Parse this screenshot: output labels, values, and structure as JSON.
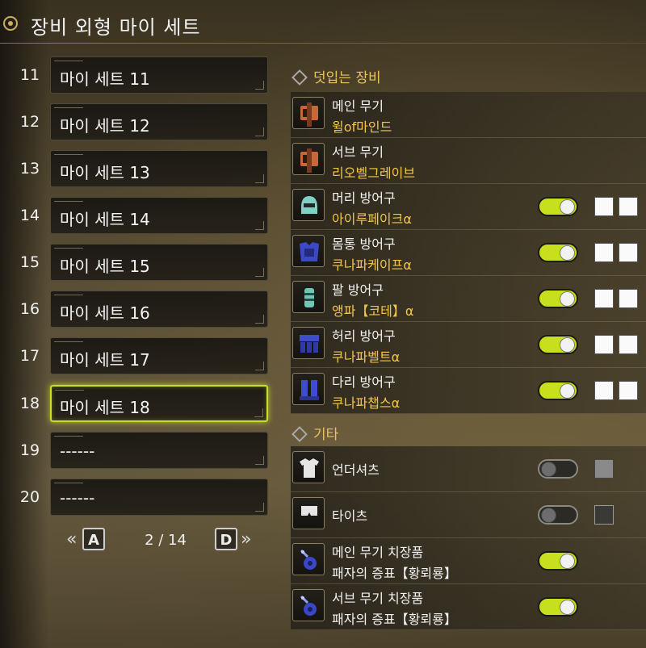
{
  "title": "장비 외형 마이 세트",
  "sets": [
    {
      "num": "11",
      "name": "마이 세트 11",
      "selected": false
    },
    {
      "num": "12",
      "name": "마이 세트 12",
      "selected": false
    },
    {
      "num": "13",
      "name": "마이 세트 13",
      "selected": false
    },
    {
      "num": "14",
      "name": "마이 세트 14",
      "selected": false
    },
    {
      "num": "15",
      "name": "마이 세트 15",
      "selected": false
    },
    {
      "num": "16",
      "name": "마이 세트 16",
      "selected": false
    },
    {
      "num": "17",
      "name": "마이 세트 17",
      "selected": false
    },
    {
      "num": "18",
      "name": "마이 세트 18",
      "selected": true
    },
    {
      "num": "19",
      "name": "------",
      "selected": false
    },
    {
      "num": "20",
      "name": "------",
      "selected": false
    }
  ],
  "pager": {
    "prev_arrow": "«",
    "prev_key": "A",
    "page": "2 / 14",
    "next_key": "D",
    "next_arrow": "»"
  },
  "equip_section": "덧입는 장비",
  "equipment": [
    {
      "slot": "메인 무기",
      "item": "윌of마인드",
      "icon": "greatsword-icon",
      "toggle": null,
      "boxes": 0
    },
    {
      "slot": "서브 무기",
      "item": "리오벨그레이브",
      "icon": "greatsword-icon",
      "toggle": null,
      "boxes": 0
    },
    {
      "slot": "머리 방어구",
      "item": "아이루페이크α",
      "icon": "helmet-icon",
      "toggle": "on",
      "boxes": 2
    },
    {
      "slot": "몸통 방어구",
      "item": "쿠나파케이프α",
      "icon": "chest-armor-icon",
      "toggle": "on",
      "boxes": 2
    },
    {
      "slot": "팔 방어구",
      "item": "앵파【코테】α",
      "icon": "gauntlet-icon",
      "toggle": "on",
      "boxes": 2
    },
    {
      "slot": "허리 방어구",
      "item": "쿠나파벨트α",
      "icon": "waist-armor-icon",
      "toggle": "on",
      "boxes": 2
    },
    {
      "slot": "다리 방어구",
      "item": "쿠나파챕스α",
      "icon": "leg-armor-icon",
      "toggle": "on",
      "boxes": 2
    }
  ],
  "other_section": "기타",
  "others": [
    {
      "label": "언더셔츠",
      "icon": "undershirt-icon",
      "toggle": "off",
      "box": "grey"
    },
    {
      "label": "타이츠",
      "icon": "tights-icon",
      "toggle": "off",
      "box": "dark"
    },
    {
      "slot": "메인 무기 치장품",
      "item": "패자의 증표【황뢰룡】",
      "icon": "charm-icon",
      "toggle": "on"
    },
    {
      "slot": "서브 무기 치장품",
      "item": "패자의 증표【황뢰룡】",
      "icon": "charm-icon",
      "toggle": "on"
    }
  ],
  "colors": {
    "accent": "#c7df1d",
    "item_text": "#f4c64a",
    "section_text": "#e9c262"
  }
}
